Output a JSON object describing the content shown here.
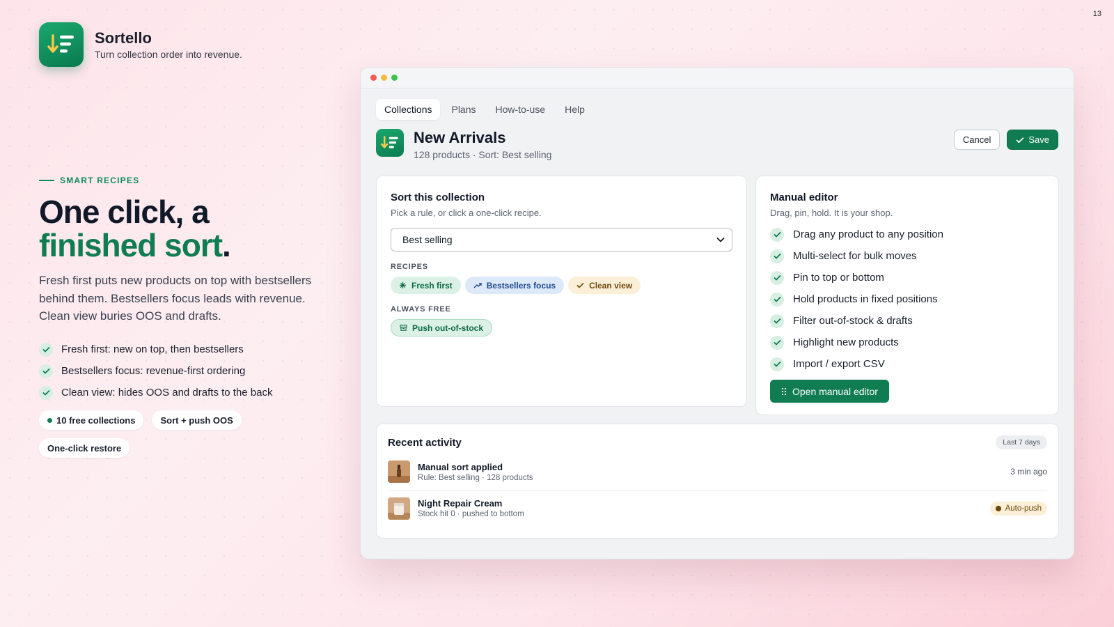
{
  "page_number": "13",
  "brand": {
    "name": "Sortello",
    "tagline": "Turn collection order into revenue."
  },
  "hero": {
    "eyebrow": "SMART RECIPES",
    "headline_line1": "One click, a",
    "headline_line2_green": "finished sort",
    "headline_period": ".",
    "description": "Fresh first puts new products on top with bestsellers behind them. Bestsellers focus leads with revenue. Clean view buries OOS and drafts.",
    "bullets": [
      "Fresh first: new on top, then bestsellers",
      "Bestsellers focus: revenue-first ordering",
      "Clean view: hides OOS and drafts to the back"
    ],
    "chips": [
      "10 free collections",
      "Sort + push OOS",
      "One-click restore"
    ]
  },
  "app": {
    "tabs": [
      "Collections",
      "Plans",
      "How-to-use",
      "Help"
    ],
    "active_tab": "Collections",
    "collection": {
      "title": "New Arrivals",
      "subtitle": "128 products · Sort: Best selling"
    },
    "actions": {
      "cancel": "Cancel",
      "save": "Save"
    },
    "sort_card": {
      "title": "Sort this collection",
      "subtitle": "Pick a rule, or click a one-click recipe.",
      "select_value": "Best selling",
      "recipes_label": "RECIPES",
      "recipes": [
        "Fresh first",
        "Bestsellers focus",
        "Clean view"
      ],
      "always_free_label": "ALWAYS FREE",
      "always_free": [
        "Push out-of-stock"
      ]
    },
    "editor_card": {
      "title": "Manual editor",
      "subtitle": "Drag, pin, hold. It is your shop.",
      "features": [
        "Drag any product to any position",
        "Multi-select for bulk moves",
        "Pin to top or bottom",
        "Hold products in fixed positions",
        "Filter out-of-stock & drafts",
        "Highlight new products",
        "Import / export CSV"
      ],
      "button": "Open manual editor"
    },
    "activity": {
      "title": "Recent activity",
      "range": "Last 7 days",
      "items": [
        {
          "title": "Manual sort applied",
          "subtitle": "Rule: Best selling · 128 products",
          "meta": "3 min ago"
        },
        {
          "title": "Night Repair Cream",
          "subtitle": "Stock hit 0 · pushed to bottom",
          "meta": "Auto-push"
        }
      ]
    }
  },
  "colors": {
    "brand_green": "#0f7c52",
    "accent_green_light": "#dcf1e6",
    "blue_pill": "#dde8f8",
    "amber_pill": "#fbefd8"
  }
}
